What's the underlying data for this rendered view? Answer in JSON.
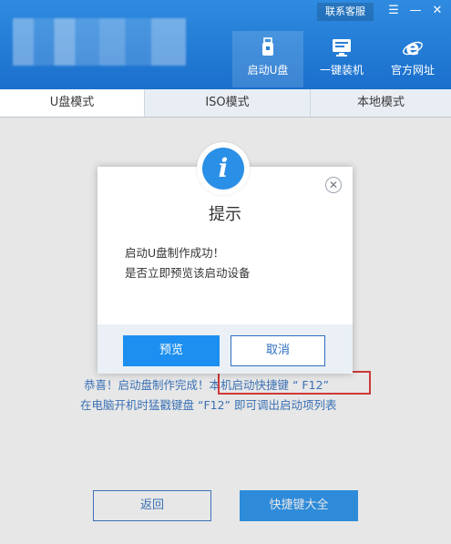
{
  "header": {
    "contact_label": "联系客服",
    "menu_icon": "menu-icon",
    "minimize_icon": "minimize-icon",
    "close_icon": "close-icon",
    "nav": [
      {
        "label": "启动U盘",
        "icon": "usb-drive-icon",
        "active": true
      },
      {
        "label": "一键装机",
        "icon": "monitor-icon",
        "active": false
      },
      {
        "label": "官方网址",
        "icon": "browser-e-icon",
        "active": false
      }
    ]
  },
  "tabs": [
    {
      "label": "U盘模式",
      "active": true
    },
    {
      "label": "ISO模式",
      "active": false
    },
    {
      "label": "本地模式",
      "active": false
    }
  ],
  "main": {
    "message_line1": "恭喜！启动盘制作完成！本机启动快捷键 “ F12”",
    "message_line2": "在电脑开机时猛戳键盘 “F12” 即可调出启动项列表",
    "back_label": "返回",
    "shortcut_label": "快捷键大全"
  },
  "dialog": {
    "title": "提示",
    "line1": "启动U盘制作成功！",
    "line2": "是否立即预览该启动设备",
    "preview_label": "预览",
    "cancel_label": "取消",
    "info_icon_glyph": "i"
  },
  "colors": {
    "header_blue": "#1f78d4",
    "accent_blue": "#1d8ff0",
    "text_blue": "#2d6fc2",
    "highlight_red": "#e02a2a"
  }
}
